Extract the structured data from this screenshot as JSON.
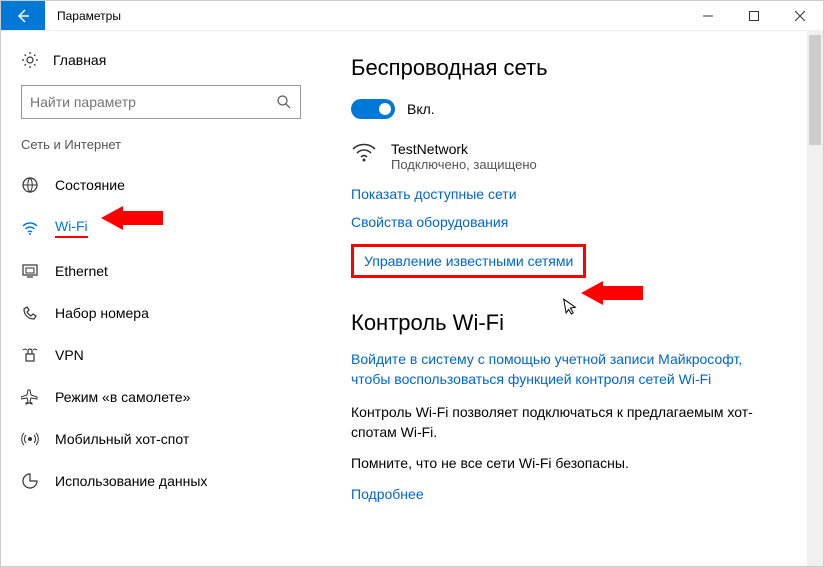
{
  "titlebar": {
    "title": "Параметры"
  },
  "sidebar": {
    "home": "Главная",
    "search_placeholder": "Найти параметр",
    "section": "Сеть и Интернет",
    "items": [
      {
        "label": "Состояние"
      },
      {
        "label": "Wi-Fi"
      },
      {
        "label": "Ethernet"
      },
      {
        "label": "Набор номера"
      },
      {
        "label": "VPN"
      },
      {
        "label": "Режим «в самолете»"
      },
      {
        "label": "Мобильный хот-спот"
      },
      {
        "label": "Использование данных"
      }
    ]
  },
  "content": {
    "heading": "Беспроводная сеть",
    "toggle_label": "Вкл.",
    "network": {
      "name": "TestNetwork",
      "status": "Подключено, защищено"
    },
    "link_available": "Показать доступные сети",
    "link_hardware": "Свойства оборудования",
    "link_manage": "Управление известными сетями",
    "wifi_control_heading": "Контроль Wi-Fi",
    "login_link": "Войдите в систему с помощью учетной записи Майкрософт, чтобы воспользоваться функцией контроля сетей Wi-Fi",
    "para1": "Контроль Wi-Fi позволяет подключаться к предлагаемым хот-спотам Wi-Fi.",
    "para2": "Помните, что не все сети Wi-Fi безопасны.",
    "link_more": "Подробнее"
  }
}
